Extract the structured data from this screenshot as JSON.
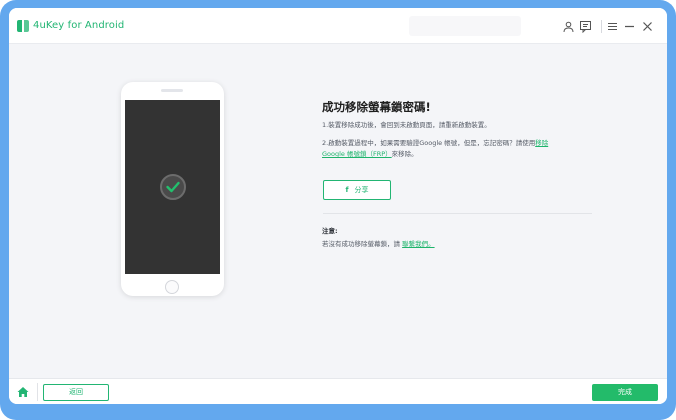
{
  "app": {
    "name": "4uKey for Android",
    "brand_color": "#22b573",
    "icons": [
      "account-icon",
      "feedback-icon",
      "menu-icon",
      "minimize-icon",
      "close-icon"
    ]
  },
  "result": {
    "title": "成功移除螢幕鎖密碼!",
    "step1": "1.裝置移除成功後，會回到未啟動頁面，請重新啟動裝置。",
    "step2_line1_prefix": "2.啟動裝置過程中，如果需要驗證Google 帳號，但是，忘記密碼？請使用",
    "step2_link_part1": "移除",
    "step2_link_part2": "Google 帳號鎖（FRP）",
    "step2_suffix": "來移除。",
    "share_icon": "f",
    "share_label": "分享",
    "note_label": "注意:",
    "note_text": "若沒有成功移除螢幕鎖，請 ",
    "note_link": "聯繫我們。"
  },
  "footer": {
    "back_label": "返回",
    "done_label": "完成"
  }
}
